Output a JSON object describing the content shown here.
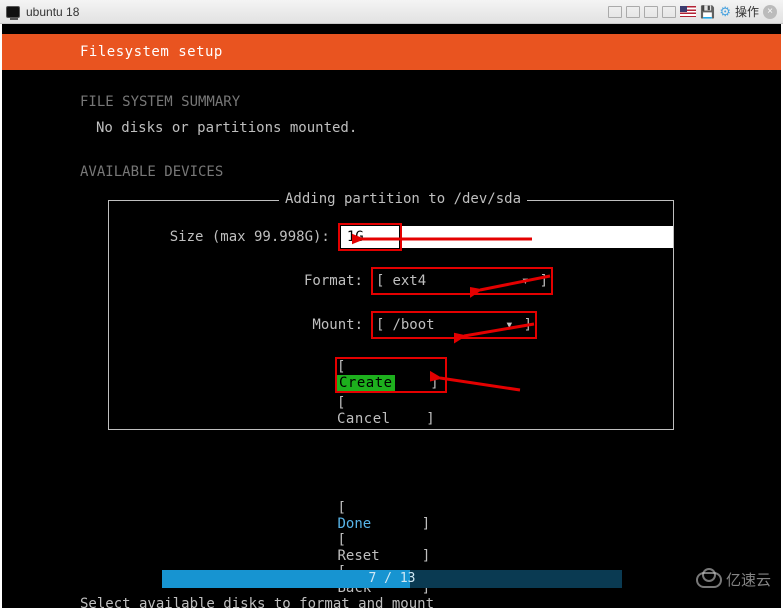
{
  "vm": {
    "title": "ubuntu 18",
    "action_label": "操作"
  },
  "header": {
    "title": "Filesystem setup"
  },
  "summary": {
    "heading": "FILE SYSTEM SUMMARY",
    "body": "No disks or partitions mounted."
  },
  "devices": {
    "heading": "AVAILABLE DEVICES"
  },
  "dialog": {
    "title": "Adding partition to /dev/sda",
    "size_label": "Size (max 99.998G):",
    "size_value": "1G",
    "format_label": "Format:",
    "format_value": "ext4",
    "mount_label": "Mount:",
    "mount_value": "/boot",
    "create_label": "Create",
    "cancel_label": "Cancel"
  },
  "footer": {
    "done_label": "Done",
    "reset_label": "Reset",
    "back_label": "Back"
  },
  "progress": {
    "current": 7,
    "total": 13,
    "text": "7 / 13"
  },
  "hint": "Select available disks to format and mount",
  "watermark": "亿速云",
  "colors": {
    "accent": "#e95420",
    "highlight_red": "#e40000",
    "highlight_green": "#1db01d",
    "progress_fill": "#1794d1",
    "progress_bg": "#0a3a52"
  }
}
